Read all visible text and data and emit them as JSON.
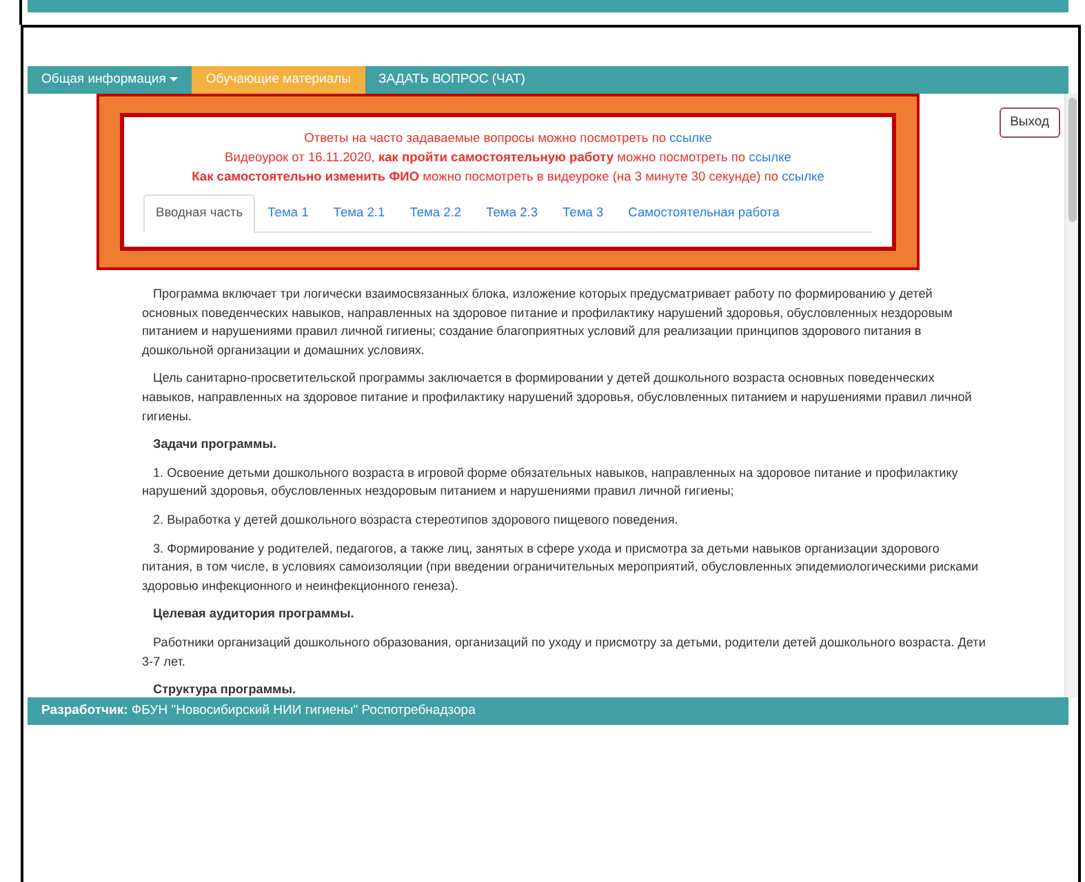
{
  "nav": [
    {
      "label": "Общая информация",
      "kind": "dropdown",
      "selected": false
    },
    {
      "label": "Обучающие материалы",
      "kind": "link",
      "selected": true
    },
    {
      "label": "ЗАДАТЬ ВОПРОС (ЧАТ)",
      "kind": "link",
      "selected": false
    }
  ],
  "logout_button": "Выход",
  "notices": [
    {
      "text": "Ответы на часто задаваемые вопросы можно посмотреть по",
      "link": "ссылке"
    },
    {
      "text": "Видеоурок от 16.11.2020, **как пройти самостоятельную работу** можно посмотреть по",
      "link": "ссылке"
    },
    {
      "text": "**Как самостоятельно изменить ФИО** можно посмотреть в видеуроке (на 3 минуте 30 секунде) по",
      "link": "ссылке"
    }
  ],
  "tabs": [
    {
      "label": "Вводная часть",
      "selected": true
    },
    {
      "label": "Тема 1",
      "selected": false
    },
    {
      "label": "Тема 2.1",
      "selected": false
    },
    {
      "label": "Тема 2.2",
      "selected": false
    },
    {
      "label": "Тема 2.3",
      "selected": false
    },
    {
      "label": "Тема 3",
      "selected": false
    },
    {
      "label": "Самостоятельная работа",
      "selected": false
    }
  ],
  "content": [
    {
      "kind": "paragraph",
      "text": "Программа включает три логически взаимосвязанных блока, изложение которых предусматривает работу по формированию у детей основных поведенческих навыков, направленных на здоровое питание и профилактику нарушений здоровья, обусловленных нездоровым питанием и нарушениями правил личной гигиены; создание благоприятных условий для реализации принципов здорового питания в дошкольной организации и домашних условиях."
    },
    {
      "kind": "paragraph",
      "text": "Цель санитарно-просветительской программы заключается в формировании у детей дошкольного возраста основных поведенческих навыков, направленных на здоровое питание и профилактику нарушений здоровья, обусловленных питанием и нарушениями правил личной гигиены."
    },
    {
      "kind": "heading",
      "text": "Задачи программы."
    },
    {
      "kind": "paragraph",
      "text": "1. Освоение детьми дошкольного возраста в игровой форме обязательных навыков, направленных на здоровое питание и профилактику нарушений здоровья, обусловленных нездоровым питанием и нарушениями правил личной гигиены;"
    },
    {
      "kind": "paragraph",
      "text": "2. Выработка у детей дошкольного возраста стереотипов здорового пищевого поведения."
    },
    {
      "kind": "paragraph",
      "text": "3. Формирование у родителей, педагогов, а также лиц, занятых в сфере ухода и присмотра за детьми навыков организации здорового питания, в том числе, в условиях самоизоляции (при введении ограничительных мероприятий, обусловленных эпидемиологическими рисками здоровью инфекционного и неинфекционного генеза)."
    },
    {
      "kind": "heading",
      "text": "Целевая аудитория программы."
    },
    {
      "kind": "paragraph",
      "text": "Работники организаций дошкольного образования, организаций по уходу и присмотру за детьми, родители детей дошкольного возраста. Дети 3-7 лет."
    },
    {
      "kind": "heading",
      "text": "Структура программы."
    }
  ],
  "footer": "**Разработчик:** ФБУН \"Новосибирский НИИ гигиены\" Роспотребнадзора"
}
